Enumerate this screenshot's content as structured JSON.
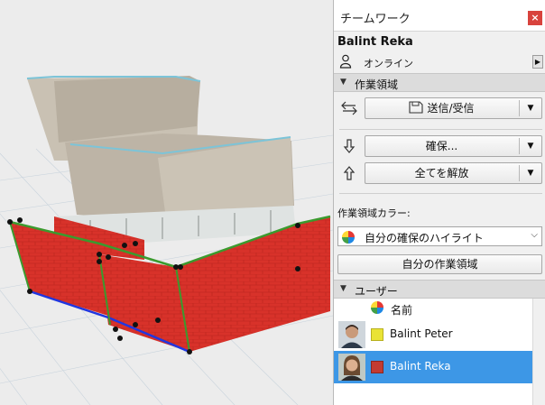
{
  "palette": {
    "title": "チームワーク",
    "close_label": "×",
    "user_name": "Balint Reka",
    "status": "オンライン",
    "workspace_section": "作業領域",
    "send_receive_label": "送信/受信",
    "reserve_label": "確保...",
    "release_all_label": "全てを解放",
    "color_label": "作業領域カラー:",
    "color_select_value": "自分の確保のハイライト",
    "my_workspace_button": "自分の作業領域",
    "users_section": "ユーザー",
    "column_name": "名前",
    "users": [
      {
        "name": "Balint Peter",
        "color": "#e9e335",
        "selected": false
      },
      {
        "name": "Balint Reka",
        "color": "#c23b32",
        "selected": true
      }
    ]
  },
  "colors": {
    "selection": "#3d97e6",
    "close": "#d8433d",
    "brick": "#d8322a",
    "roof": "#c9c1b3"
  },
  "icons": {
    "person": "person-icon",
    "send_receive": "arrows-exchange-icon",
    "reserve": "arrow-down-icon",
    "release": "arrow-up-icon",
    "color_wheel": "color-wheel-icon"
  }
}
